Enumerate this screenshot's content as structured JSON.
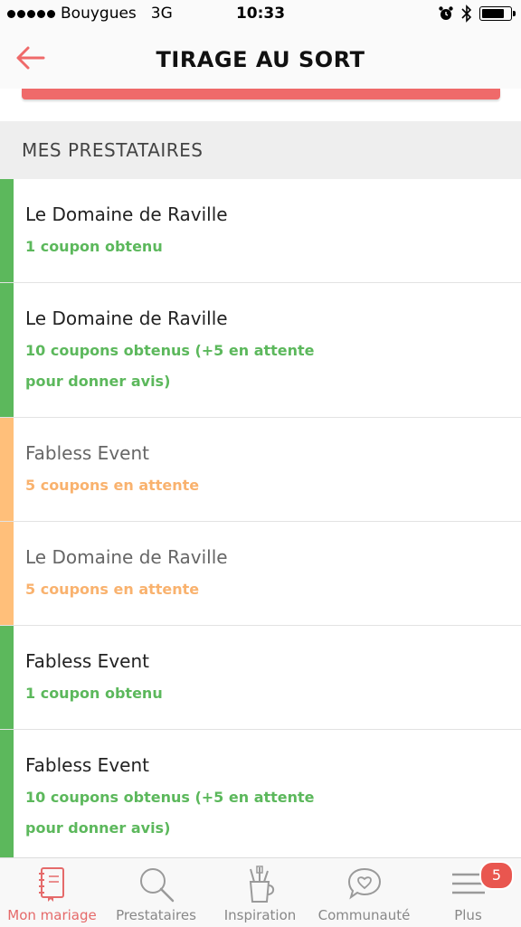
{
  "status_bar": {
    "carrier": "Bouygues",
    "network": "3G",
    "time": "10:33",
    "battery_level": 0.85
  },
  "nav": {
    "title": "TIRAGE AU SORT",
    "back_icon": "arrow-left-icon",
    "accent_color": "#ef6a6a"
  },
  "section": {
    "title": "MES PRESTATAIRES"
  },
  "items": [
    {
      "name": "Le Domaine de Raville",
      "status": "1 coupon obtenu",
      "state": "green"
    },
    {
      "name": "Le Domaine de Raville",
      "status": "10 coupons obtenus (+5 en attente pour donner avis)",
      "state": "green"
    },
    {
      "name": "Fabless Event",
      "status": "5 coupons en attente",
      "state": "orange"
    },
    {
      "name": "Le Domaine de Raville",
      "status": "5 coupons en attente",
      "state": "orange"
    },
    {
      "name": "Fabless Event",
      "status": "1 coupon obtenu",
      "state": "green"
    },
    {
      "name": "Fabless Event",
      "status": "10 coupons obtenus (+5 en attente pour donner avis)",
      "state": "green"
    }
  ],
  "colors": {
    "green": "#5cb85c",
    "orange": "#ffbf7a",
    "active_tab": "#e56a6a"
  },
  "tabbar": {
    "tabs": [
      {
        "label": "Mon mariage",
        "icon": "notebook-icon"
      },
      {
        "label": "Prestataires",
        "icon": "search-icon"
      },
      {
        "label": "Inspiration",
        "icon": "brush-cup-icon"
      },
      {
        "label": "Communauté",
        "icon": "heart-bubble-icon"
      },
      {
        "label": "Plus",
        "icon": "menu-icon"
      }
    ],
    "badge": "5"
  }
}
